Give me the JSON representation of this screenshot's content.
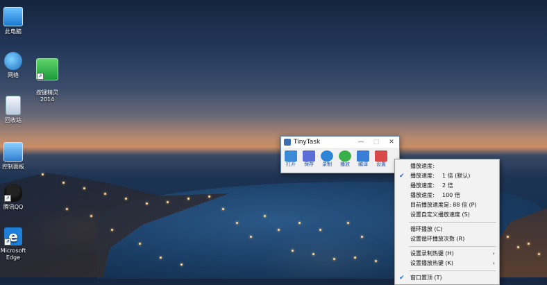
{
  "desktop": {
    "icons": [
      {
        "label": "此电脑",
        "icon": "computer-icon"
      },
      {
        "label": "网络",
        "icon": "network-icon"
      },
      {
        "label": "回收站",
        "icon": "recycle-bin-icon"
      },
      {
        "label": "控制面板",
        "icon": "control-panel-icon"
      },
      {
        "label": "腾讯QQ",
        "icon": "qq-penguin-icon"
      },
      {
        "label": "Microsoft Edge",
        "icon": "edge-icon"
      },
      {
        "label": "按键精灵\n2014",
        "icon": "anjian-icon"
      }
    ]
  },
  "tinytask": {
    "title": "TinyTask",
    "controls": {
      "minimize": "—",
      "maximize": "□",
      "close": "✕"
    },
    "tools": [
      {
        "label": "打开",
        "icon": "open-icon",
        "color": "#3b8ad8"
      },
      {
        "label": "保存",
        "icon": "save-icon",
        "color": "#5b6ed8"
      },
      {
        "label": "录制",
        "icon": "record-icon",
        "color": "#2f86d8"
      },
      {
        "label": "播放",
        "icon": "play-icon",
        "color": "#3ab04a"
      },
      {
        "label": "编译",
        "icon": "compile-icon",
        "color": "#3b7ed8"
      },
      {
        "label": "设置",
        "icon": "settings-icon",
        "color": "#d84a4a"
      }
    ]
  },
  "menu": {
    "items": [
      {
        "text": "播放速度:",
        "checked": false
      },
      {
        "text": "播放速度:",
        "value": "1 倍 (默认)",
        "checked": true
      },
      {
        "text": "播放速度:",
        "value": "2 倍",
        "checked": false
      },
      {
        "text": "播放速度:",
        "value": "100 倍",
        "checked": false
      },
      {
        "text": "目前播放速度是: 88 倍 (P)",
        "checked": false
      },
      {
        "text": "设置自定义播放速度 (S)",
        "checked": false
      },
      {
        "sep": true
      },
      {
        "text": "循环播放 (C)",
        "checked": false
      },
      {
        "text": "设置循环播放次数 (R)",
        "checked": false
      },
      {
        "sep": true
      },
      {
        "text": "设置录制热键 (H)",
        "submenu": true,
        "checked": false
      },
      {
        "text": "设置播放热键 (K)",
        "submenu": true,
        "checked": false
      },
      {
        "sep": true
      },
      {
        "text": "窗口置顶 (T)",
        "checked": true
      }
    ],
    "check_glyph": "✔",
    "arrow_glyph": "›"
  }
}
